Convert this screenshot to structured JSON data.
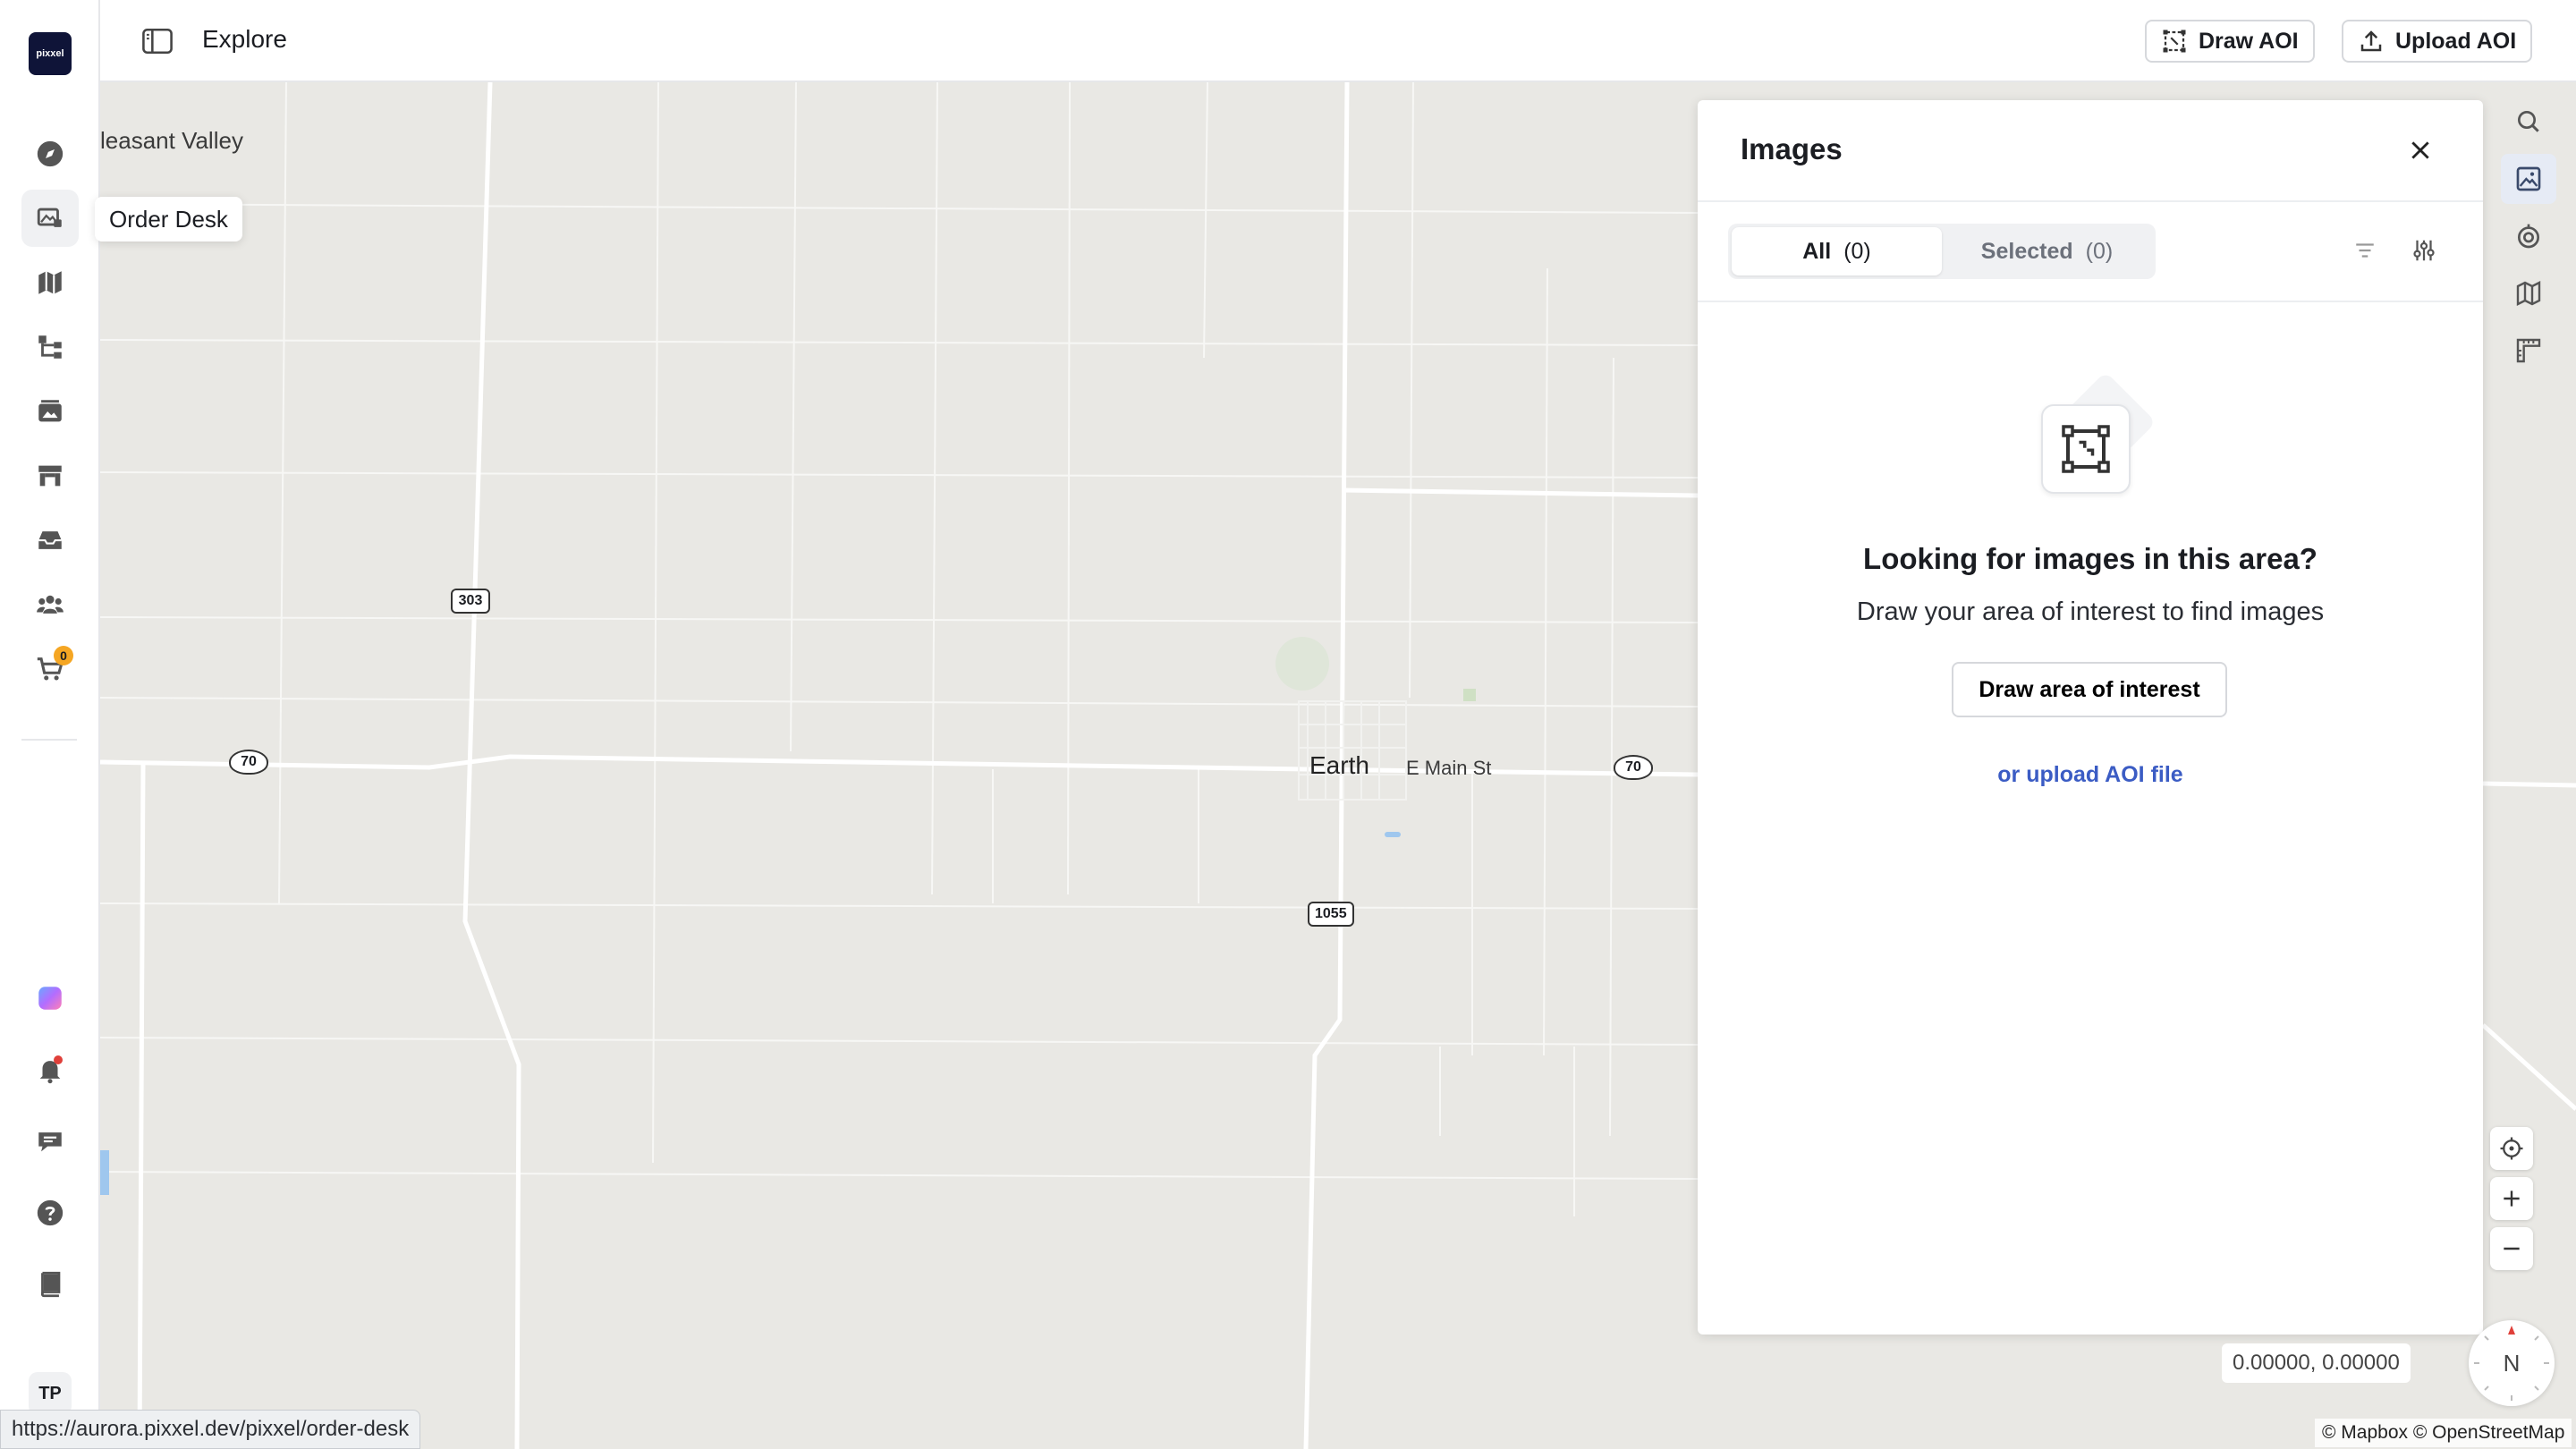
{
  "app": {
    "logo_text": "pixxel"
  },
  "topbar": {
    "title": "Explore",
    "draw_aoi_label": "Draw AOI",
    "upload_aoi_label": "Upload AOI"
  },
  "sidebar": {
    "items": [
      {
        "icon": "compass-icon"
      },
      {
        "icon": "order-desk-icon",
        "tooltip": "Order Desk"
      },
      {
        "icon": "map-icon"
      },
      {
        "icon": "workflow-icon"
      },
      {
        "icon": "gallery-icon"
      },
      {
        "icon": "store-icon"
      },
      {
        "icon": "archive-icon"
      },
      {
        "icon": "team-icon"
      },
      {
        "icon": "cart-icon",
        "badge": "0"
      }
    ],
    "bottom_items": [
      {
        "icon": "aurora-icon"
      },
      {
        "icon": "bell-icon"
      },
      {
        "icon": "chat-icon"
      },
      {
        "icon": "help-icon"
      },
      {
        "icon": "docs-icon"
      }
    ],
    "avatar_initials": "TP",
    "tooltip": "Order Desk"
  },
  "map": {
    "labels": {
      "pleasant_valley": "leasant Valley",
      "earth": "Earth",
      "e_main_st": "E Main St"
    },
    "shields": {
      "s303": "303",
      "us70_left": "70",
      "us70_right": "70",
      "s1055": "1055"
    },
    "coordinates": "0.00000, 0.00000",
    "compass": "N",
    "attribution": "© Mapbox © OpenStreetMap"
  },
  "images_panel": {
    "title": "Images",
    "tabs": [
      {
        "label": "All",
        "count": "(0)"
      },
      {
        "label": "Selected",
        "count": "(0)"
      }
    ],
    "empty_title": "Looking for images in this area?",
    "empty_subtitle": "Draw your area of interest to find images",
    "draw_button": "Draw area of interest",
    "upload_link": "or upload AOI file"
  },
  "status_bar": {
    "url": "https://aurora.pixxel.dev/pixxel/order-desk"
  },
  "colors": {
    "accent": "#3b5cc4",
    "logo_bg": "#0f1438",
    "badge": "#f5a623"
  }
}
